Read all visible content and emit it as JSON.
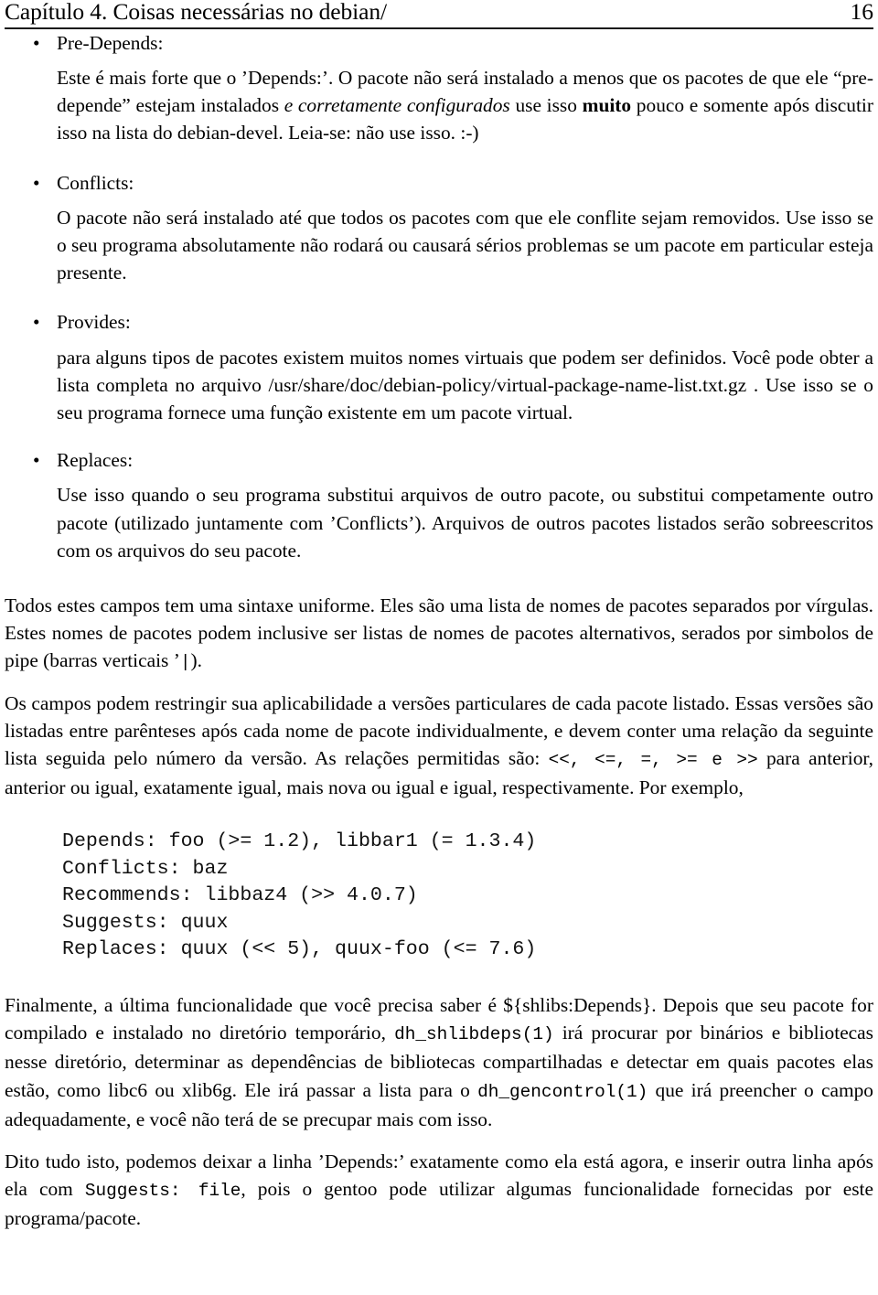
{
  "header": {
    "chapter_title": "Capítulo 4. Coisas necessárias no debian/",
    "page_number": "16"
  },
  "bullet_glyph": "•",
  "list": [
    {
      "term": "Pre-Depends:",
      "body_pre": "Este é mais forte que o ’Depends:’.  O pacote não será instalado a menos que os pacotes de que ele “pre-depende” estejam instalados ",
      "body_italic": "e corretamente configurados",
      "body_mid": " use isso ",
      "body_bold": "muito",
      "body_post": " pouco e somente após discutir isso na lista do debian-devel. Leia-se: não use isso. :-)"
    },
    {
      "term": "Conflicts:",
      "body": "O pacote não será instalado até que todos os pacotes com que ele conflite sejam removidos.  Use isso se o seu programa absolutamente não rodará ou causará sérios problemas se um pacote em particular esteja presente."
    },
    {
      "term": "Provides:",
      "body": "para alguns tipos de pacotes existem muitos nomes virtuais que podem ser definidos. Você pode obter a lista completa no arquivo /usr/share/doc/debian-policy/virtual-package-name-list.txt.gz . Use isso se o seu programa fornece uma função existente em um pacote virtual."
    },
    {
      "term": "Replaces:",
      "body": "Use isso quando o seu programa substitui arquivos de outro pacote, ou substitui competamente outro pacote (utilizado juntamente com ’Conflicts’).  Arquivos de outros pacotes listados serão sobreescritos com os arquivos do seu pacote."
    }
  ],
  "paragraphs": {
    "p1": "Todos estes campos tem uma sintaxe uniforme.  Eles são uma lista de nomes de pacotes separados por vírgulas.  Estes nomes de pacotes podem inclusive ser listas de nomes de pacotes alternativos, serados por simbolos de pipe (barras verticais ’",
    "p1_pipe": "|",
    "p1_end": ").",
    "p2_a": "Os campos podem restringir sua aplicabilidade a versões particulares de cada pacote listado. Essas versões são listadas entre parênteses após cada nome de pacote individualmente, e devem conter uma relação da seguinte lista seguida pelo número da versão.  As relações permitidas são: ",
    "p2_ops": "<<, <=, =, >= e >>",
    "p2_b": " para anterior, anterior ou igual, exatamente igual, mais nova ou igual e igual, respectivamente.  Por exemplo,"
  },
  "code_block": [
    "Depends: foo (>= 1.2), libbar1 (= 1.3.4)",
    "Conflicts: baz",
    "Recommends: libbaz4 (>> 4.0.7)",
    "Suggests: quux",
    "Replaces: quux (<< 5), quux-foo (<= 7.6)"
  ],
  "tail": {
    "p3_a": "Finalmente, a última funcionalidade que você precisa saber é ${shlibs:Depends}.  Depois que seu pacote for compilado e instalado no diretório temporário, ",
    "p3_mono1": "dh_shlibdeps(1)",
    "p3_b": " irá procurar por binários e bibliotecas nesse diretório, determinar as dependências de bibliotecas compartilhadas e detectar em quais pacotes elas estão, como libc6 ou xlib6g.  Ele irá passar a lista para o ",
    "p3_mono2": "dh_gencontrol(1)",
    "p3_c": " que irá preencher o campo adequadamente, e você não terá de se precupar mais com isso.",
    "p4_a": "Dito tudo isto, podemos deixar a linha ’Depends:’ exatamente como ela está agora, e inserir outra linha após ela com ",
    "p4_mono": "Suggests:   file",
    "p4_b": ", pois o gentoo pode utilizar algumas funcionalidade fornecidas por este programa/pacote."
  }
}
